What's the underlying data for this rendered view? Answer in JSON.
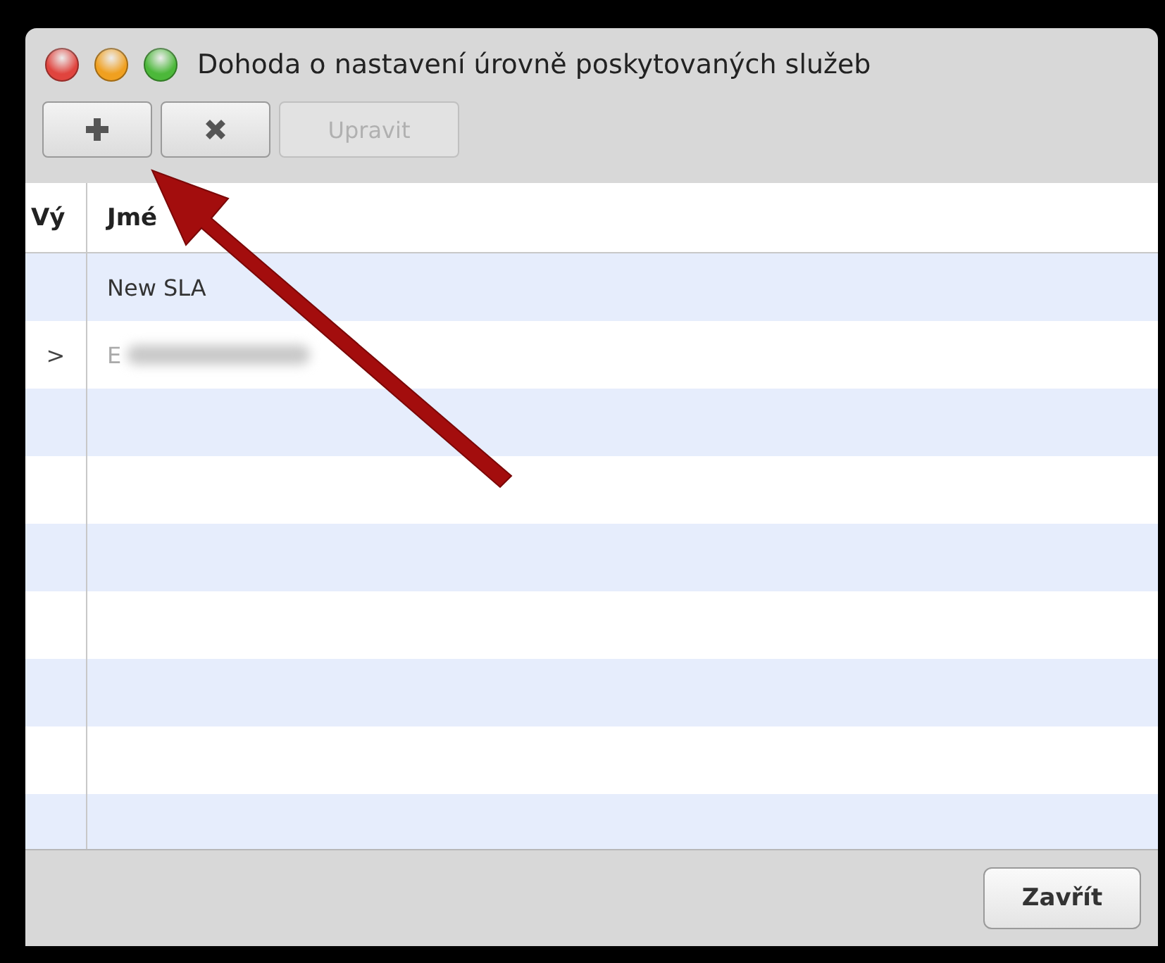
{
  "window": {
    "title": "Dohoda o nastavení úrovně poskytovaných služeb"
  },
  "toolbar": [
    {
      "kind": "add",
      "disabled": false
    },
    {
      "kind": "delete",
      "disabled": false
    },
    {
      "kind": "text",
      "label": "Upravit",
      "disabled": true
    }
  ],
  "table": {
    "columns": [
      "Vý",
      "Jmé"
    ],
    "rows": [
      {
        "marker": "",
        "name": "New SLA",
        "blurred": false
      },
      {
        "marker": ">",
        "name": "E",
        "blurred": true
      }
    ]
  },
  "buttons": [
    "Zavřít"
  ]
}
